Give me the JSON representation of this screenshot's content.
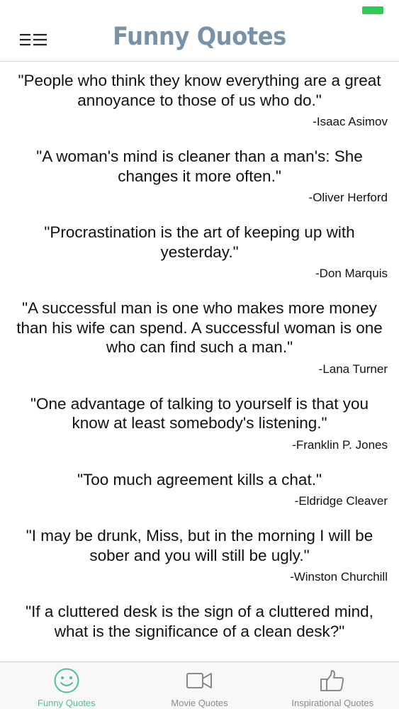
{
  "colors": {
    "accent": "#4cbfa2",
    "title": "#7a92a6",
    "battery": "#2ecc55",
    "inactive": "#8a8a8a"
  },
  "header": {
    "title": "Funny Quotes",
    "menu_icon": "hamburger-menu-icon"
  },
  "quotes": [
    {
      "text": "\"People who think they know everything are a great annoyance to those of us who do.\"",
      "author": "-Isaac Asimov"
    },
    {
      "text": "\"A woman's mind is cleaner than a man's: She changes it more often.\"",
      "author": "-Oliver Herford"
    },
    {
      "text": "\"Procrastination is the art of keeping up with yesterday.\"",
      "author": "-Don Marquis"
    },
    {
      "text": "\"A successful man is one who makes more money than his wife can spend. A successful woman is one who can find such a man.\"",
      "author": "-Lana Turner"
    },
    {
      "text": "\"One advantage of talking to yourself is that you know at least somebody's listening.\"",
      "author": "-Franklin P. Jones"
    },
    {
      "text": "\"Too much agreement kills a chat.\"",
      "author": "-Eldridge Cleaver"
    },
    {
      "text": "\"I may be drunk, Miss, but in the morning I will be sober and you will still be ugly.\"",
      "author": "-Winston Churchill"
    },
    {
      "text": "\"If a cluttered desk is the sign of a cluttered mind, what is the significance of a clean desk?\"",
      "author": ""
    }
  ],
  "tabs": [
    {
      "label": "Funny Quotes",
      "icon": "smiley-face-icon",
      "active": true
    },
    {
      "label": "Movie Quotes",
      "icon": "video-camera-icon",
      "active": false
    },
    {
      "label": "Inspirational Quotes",
      "icon": "thumbs-up-icon",
      "active": false
    }
  ]
}
